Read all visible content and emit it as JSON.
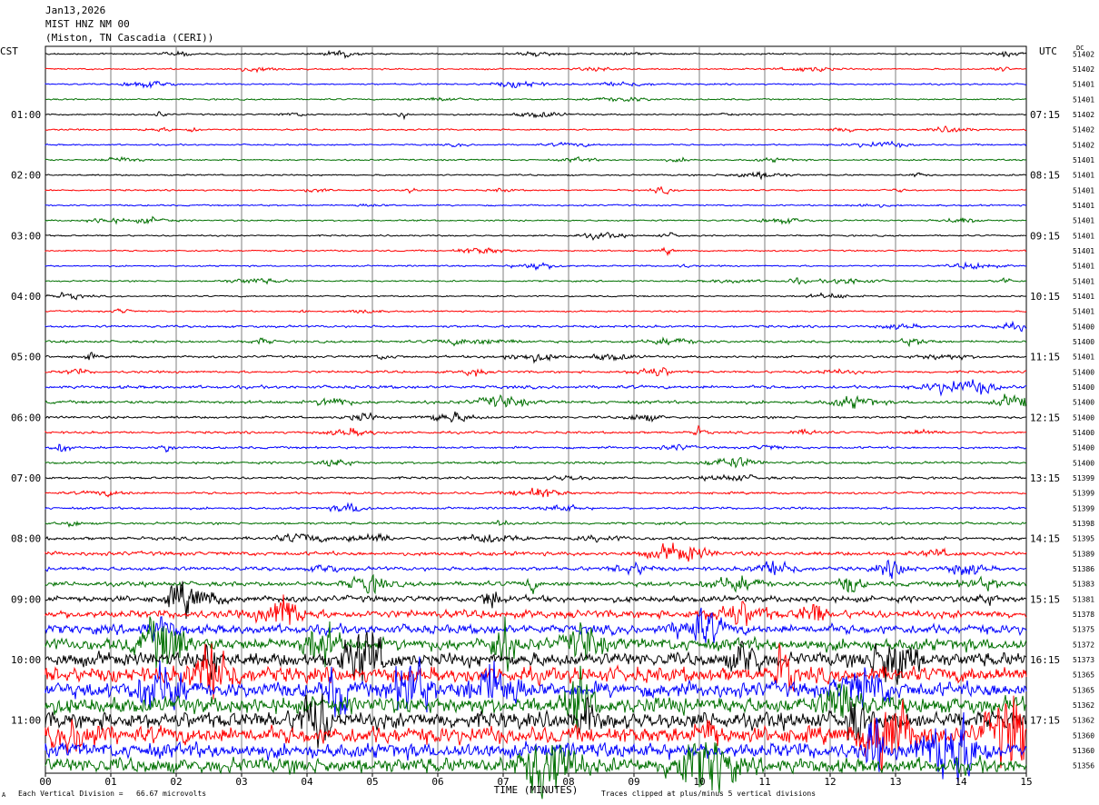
{
  "header": {
    "date": "Jan13,2026",
    "station": "MIST HNZ NM 00",
    "location": "(Miston, TN Cascadia (CERI))"
  },
  "footer": {
    "scale": "Each Vertical Division =   66.67 microvolts",
    "clip": "Traces clipped at plus/minus 5 vertical divisions",
    "corner_mark": "A"
  },
  "chart_data": {
    "type": "line",
    "title": "",
    "xlabel": "TIME (MINUTES)",
    "left_label": "CST",
    "right_label": "UTC",
    "dc_label": "DC",
    "xlim": [
      0,
      15
    ],
    "x_ticks": [
      "00",
      "01",
      "02",
      "03",
      "04",
      "05",
      "06",
      "07",
      "08",
      "09",
      "10",
      "11",
      "12",
      "13",
      "14",
      "15"
    ],
    "rows_per_hour": 4,
    "row_count": 48,
    "trace_colors": [
      "#000000",
      "#ff0000",
      "#0000ff",
      "#007000"
    ],
    "left_hour_labels": [
      "01:00",
      "02:00",
      "03:00",
      "04:00",
      "05:00",
      "06:00",
      "07:00",
      "08:00",
      "09:00",
      "10:00",
      "11:00"
    ],
    "right_hour_labels": [
      "07:15",
      "08:15",
      "09:15",
      "10:15",
      "11:15",
      "12:15",
      "13:15",
      "14:15",
      "15:15",
      "16:15",
      "17:15"
    ],
    "hour_label_first_row": 4,
    "dc_values": [
      "51402",
      "51402",
      "51401",
      "51401",
      "51402",
      "51402",
      "51402",
      "51401",
      "51401",
      "51401",
      "51401",
      "51401",
      "51401",
      "51401",
      "51401",
      "51401",
      "51401",
      "51401",
      "51400",
      "51400",
      "51401",
      "51400",
      "51400",
      "51400",
      "51400",
      "51400",
      "51400",
      "51400",
      "51399",
      "51399",
      "51399",
      "51398",
      "51395",
      "51389",
      "51386",
      "51383",
      "51381",
      "51378",
      "51375",
      "51372",
      "51373",
      "51365",
      "51365",
      "51362",
      "51362",
      "51360",
      "51360",
      "51356"
    ],
    "row_amplitude": [
      1.0,
      1.0,
      1.0,
      1.0,
      1.0,
      1.0,
      1.0,
      1.0,
      1.0,
      1.0,
      1.0,
      1.0,
      1.0,
      1.0,
      1.0,
      1.0,
      1.0,
      1.0,
      1.5,
      1.5,
      1.5,
      1.5,
      2.0,
      2.0,
      1.5,
      1.5,
      1.5,
      1.5,
      1.5,
      1.5,
      1.5,
      1.5,
      2.0,
      2.5,
      2.5,
      3.0,
      4.0,
      5.0,
      6.0,
      8.0,
      9.0,
      10.0,
      10.0,
      11.0,
      11.0,
      11.0,
      10.0,
      10.0
    ]
  }
}
